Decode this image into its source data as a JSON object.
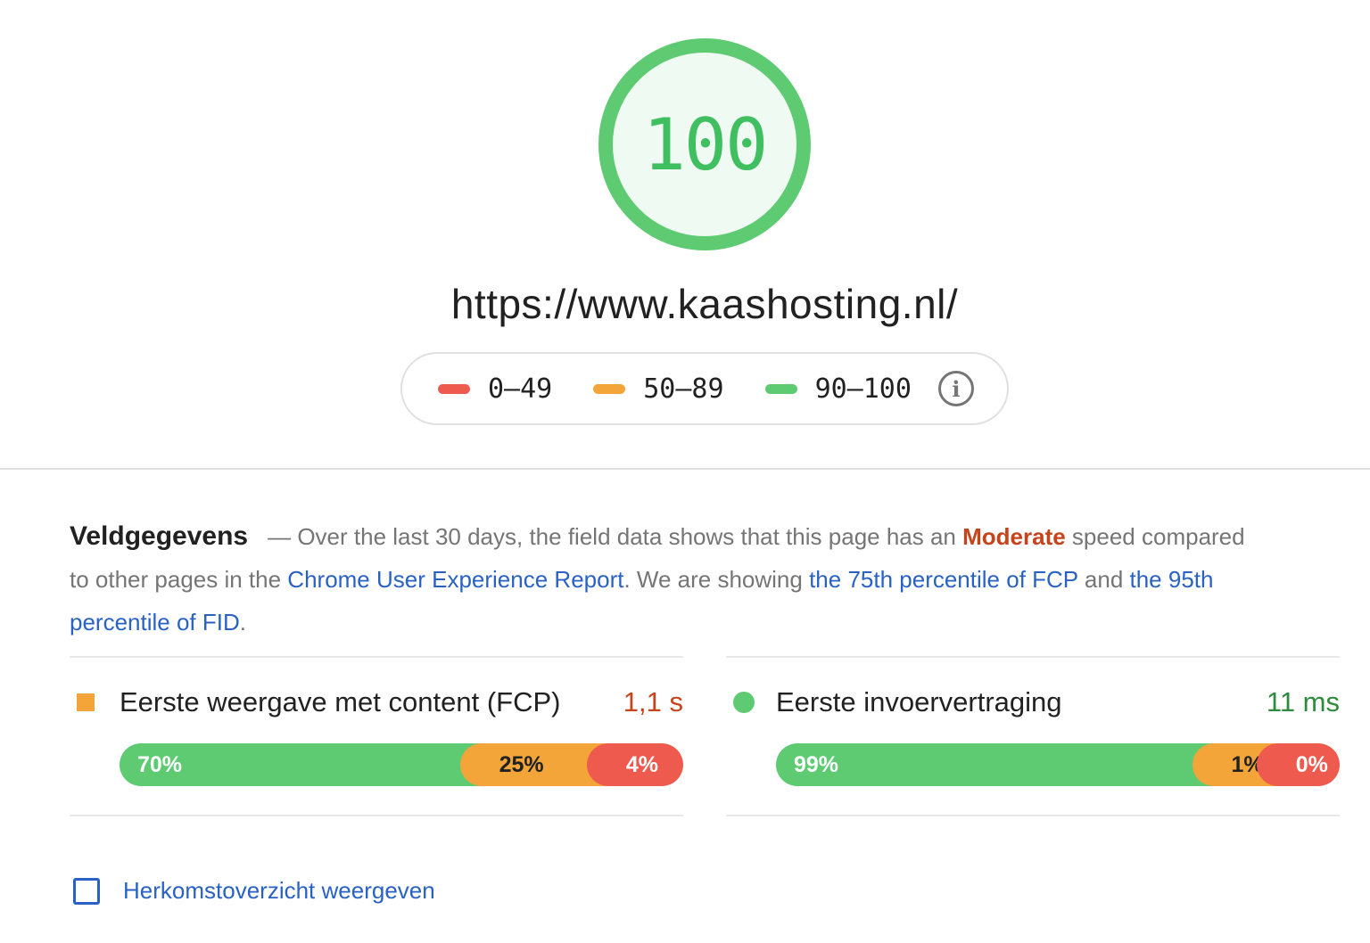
{
  "score": {
    "value": "100",
    "color": "#5ecb72",
    "fill": "#effaf2",
    "fraction": 1.0
  },
  "url": "https://www.kaashosting.nl/",
  "legend": {
    "items": [
      {
        "label": "0–49",
        "color": "#ef5a4f"
      },
      {
        "label": "50–89",
        "color": "#f4a53a"
      },
      {
        "label": "90–100",
        "color": "#5ecb72"
      }
    ],
    "info_icon": "info-icon"
  },
  "field_data": {
    "title": "Veldgegevens",
    "dash": "—",
    "text1": " Over the last 30 days, the field data shows that this page has an ",
    "speed_word": "Moderate",
    "text2": " speed compared to other pages in the ",
    "link1": "Chrome User Experience Report",
    "text3": ". We are showing ",
    "link2": "the 75th percentile of FCP",
    "text4": " and ",
    "link3": "the 95th percentile of FID",
    "text5": "."
  },
  "metrics": {
    "fcp": {
      "name": "Eerste weergave met content (FCP)",
      "value": "1,1 s",
      "icon": "orange-square-icon",
      "distribution": [
        {
          "label": "70%",
          "fraction": 0.7
        },
        {
          "label": "25%",
          "fraction": 0.25
        },
        {
          "label": "4%",
          "fraction": 0.04
        }
      ]
    },
    "fid": {
      "name": "Eerste invoervertraging",
      "value": "11 ms",
      "icon": "green-circle-icon",
      "distribution": [
        {
          "label": "99%",
          "fraction": 0.99
        },
        {
          "label": "1%",
          "fraction": 0.01
        },
        {
          "label": "0%",
          "fraction": 0.0
        }
      ]
    }
  },
  "origin_summary": {
    "label": "Herkomstoverzicht weergeven",
    "checked": false
  }
}
